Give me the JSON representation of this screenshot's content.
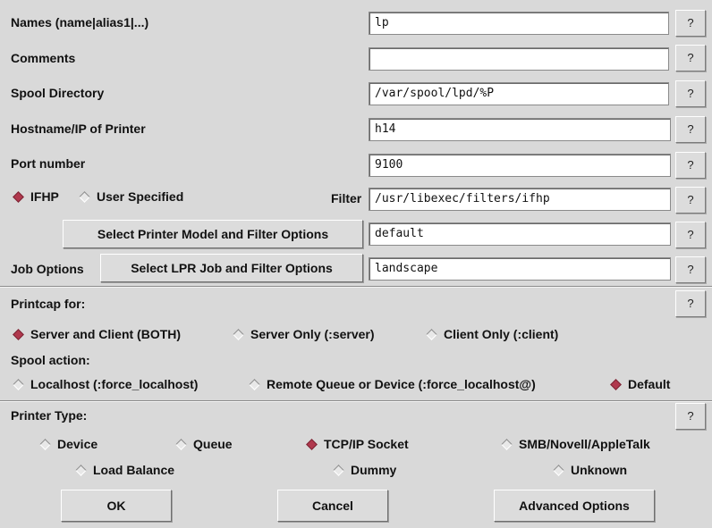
{
  "fields": {
    "names": {
      "label": "Names (name|alias1|...)",
      "value": "lp"
    },
    "comments": {
      "label": "Comments",
      "value": ""
    },
    "spool_dir": {
      "label": "Spool Directory",
      "value": "/var/spool/lpd/%P"
    },
    "hostname": {
      "label": "Hostname/IP of Printer",
      "value": "h14"
    },
    "port": {
      "label": "Port number",
      "value": "9100"
    },
    "filter": {
      "label": "Filter",
      "value": "/usr/libexec/filters/ifhp"
    },
    "model": {
      "button": "Select Printer Model and Filter Options",
      "value": "default"
    },
    "job": {
      "label": "Job Options",
      "button": "Select LPR Job and Filter Options",
      "value": "landscape"
    }
  },
  "help_label": "?",
  "filter_type": {
    "ifhp": "IFHP",
    "user": "User Specified",
    "selected": "ifhp"
  },
  "printcap": {
    "label": "Printcap for:",
    "options": [
      "Server and Client (BOTH)",
      "Server Only (:server)",
      "Client Only (:client)"
    ],
    "selected": 0
  },
  "spool_action": {
    "label": "Spool action:",
    "options": [
      "Localhost (:force_localhost)",
      "Remote Queue or Device (:force_localhost@)",
      "Default"
    ],
    "selected": 2
  },
  "printer_type": {
    "label": "Printer Type:",
    "options": [
      "Device",
      "Queue",
      "TCP/IP Socket",
      "SMB/Novell/AppleTalk",
      "Load Balance",
      "Dummy",
      "Unknown"
    ],
    "selected": 2
  },
  "buttons": {
    "ok": "OK",
    "cancel": "Cancel",
    "advanced": "Advanced Options"
  },
  "colors": {
    "background": "#d9d9d9",
    "radio_selected": "#b0384d"
  }
}
